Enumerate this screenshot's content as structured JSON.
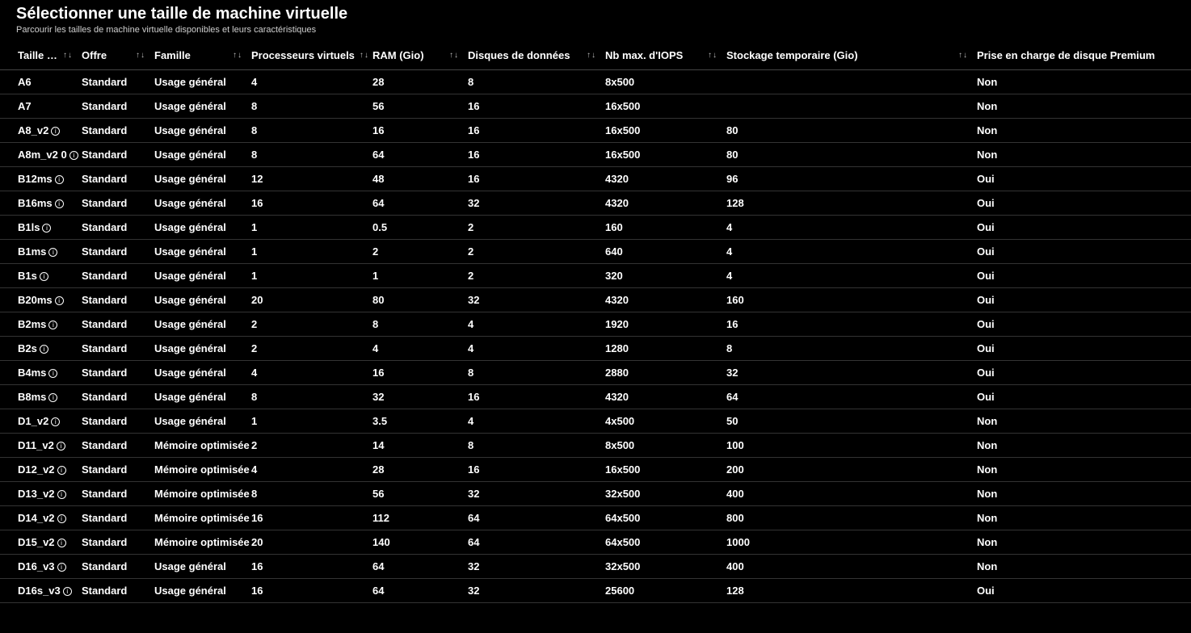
{
  "header": {
    "title": "Sélectionner une taille de machine virtuelle",
    "subtitle": "Parcourir les tailles de machine virtuelle disponibles et leurs caractéristiques"
  },
  "columns": [
    {
      "label": "Taille …",
      "sortable": true
    },
    {
      "label": "Offre",
      "sortable": true
    },
    {
      "label": "Famille",
      "sortable": true
    },
    {
      "label": "Processeurs virtuels",
      "sortable": true
    },
    {
      "label": "RAM (Gio)",
      "sortable": true
    },
    {
      "label": "Disques de données",
      "sortable": true
    },
    {
      "label": "Nb max. d'IOPS",
      "sortable": true
    },
    {
      "label": "Stockage temporaire (Gio)",
      "sortable": true
    },
    {
      "label": "Prise en charge de disque Premium",
      "sortable": false
    }
  ],
  "rows": [
    {
      "size": "A6",
      "info": false,
      "note": "",
      "offer": "Standard",
      "family": "Usage général",
      "vcpu": "4",
      "ram": "28",
      "disks": "8",
      "iops": "8x500",
      "temp": "",
      "premium": "Non"
    },
    {
      "size": "A7",
      "info": false,
      "note": "",
      "offer": "Standard",
      "family": "Usage général",
      "vcpu": "8",
      "ram": "56",
      "disks": "16",
      "iops": "16x500",
      "temp": "",
      "premium": "Non"
    },
    {
      "size": "A8_v2",
      "info": true,
      "note": "",
      "offer": "Standard",
      "family": "Usage général",
      "vcpu": "8",
      "ram": "16",
      "disks": "16",
      "iops": "16x500",
      "temp": "80",
      "premium": "Non"
    },
    {
      "size": "A8m_v2",
      "info": true,
      "note": "0",
      "offer": "Standard",
      "family": "Usage général",
      "vcpu": "8",
      "ram": "64",
      "disks": "16",
      "iops": "16x500",
      "temp": "80",
      "premium": "Non"
    },
    {
      "size": "B12ms",
      "info": true,
      "note": "",
      "offer": "Standard",
      "family": "Usage général",
      "vcpu": "12",
      "ram": "48",
      "disks": "16",
      "iops": "4320",
      "temp": "96",
      "premium": "Oui"
    },
    {
      "size": "B16ms",
      "info": true,
      "note": "",
      "offer": "Standard",
      "family": "Usage général",
      "vcpu": "16",
      "ram": "64",
      "disks": "32",
      "iops": "4320",
      "temp": "128",
      "premium": "Oui"
    },
    {
      "size": "B1ls",
      "info": true,
      "note": "",
      "offer": "Standard",
      "family": "Usage général",
      "vcpu": "1",
      "ram": "0.5",
      "disks": "2",
      "iops": "160",
      "temp": "4",
      "premium": "Oui"
    },
    {
      "size": "B1ms",
      "info": true,
      "note": "",
      "offer": "Standard",
      "family": "Usage général",
      "vcpu": "1",
      "ram": "2",
      "disks": "2",
      "iops": "640",
      "temp": "4",
      "premium": "Oui"
    },
    {
      "size": "B1s",
      "info": true,
      "note": "",
      "offer": "Standard",
      "family": "Usage général",
      "vcpu": "1",
      "ram": "1",
      "disks": "2",
      "iops": "320",
      "temp": "4",
      "premium": "Oui"
    },
    {
      "size": "B20ms",
      "info": true,
      "note": "",
      "offer": "Standard",
      "family": "Usage général",
      "vcpu": "20",
      "ram": "80",
      "disks": "32",
      "iops": "4320",
      "temp": "160",
      "premium": "Oui"
    },
    {
      "size": "B2ms",
      "info": true,
      "note": "",
      "offer": "Standard",
      "family": "Usage général",
      "vcpu": "2",
      "ram": "8",
      "disks": "4",
      "iops": "1920",
      "temp": "16",
      "premium": "Oui"
    },
    {
      "size": "B2s",
      "info": true,
      "note": "",
      "offer": "Standard",
      "family": "Usage général",
      "vcpu": "2",
      "ram": "4",
      "disks": "4",
      "iops": "1280",
      "temp": "8",
      "premium": "Oui"
    },
    {
      "size": "B4ms",
      "info": true,
      "note": "",
      "offer": "Standard",
      "family": "Usage général",
      "vcpu": "4",
      "ram": "16",
      "disks": "8",
      "iops": "2880",
      "temp": "32",
      "premium": "Oui"
    },
    {
      "size": "B8ms",
      "info": true,
      "note": "",
      "offer": "Standard",
      "family": "Usage général",
      "vcpu": "8",
      "ram": "32",
      "disks": "16",
      "iops": "4320",
      "temp": "64",
      "premium": "Oui"
    },
    {
      "size": "D1_v2",
      "info": true,
      "note": "",
      "offer": "Standard",
      "family": "Usage général",
      "vcpu": "1",
      "ram": "3.5",
      "disks": "4",
      "iops": "4x500",
      "temp": "50",
      "premium": "Non"
    },
    {
      "size": "D11_v2",
      "info": true,
      "note": "",
      "offer": "Standard",
      "family": "Mémoire optimisée",
      "vcpu": "2",
      "ram": "14",
      "disks": "8",
      "iops": "8x500",
      "temp": "100",
      "premium": "Non"
    },
    {
      "size": "D12_v2",
      "info": true,
      "note": "",
      "offer": "Standard",
      "family": "Mémoire optimisée",
      "vcpu": "4",
      "ram": "28",
      "disks": "16",
      "iops": "16x500",
      "temp": "200",
      "premium": "Non"
    },
    {
      "size": "D13_v2",
      "info": true,
      "note": "",
      "offer": "Standard",
      "family": "Mémoire optimisée",
      "vcpu": "8",
      "ram": "56",
      "disks": "32",
      "iops": "32x500",
      "temp": "400",
      "premium": "Non"
    },
    {
      "size": "D14_v2",
      "info": true,
      "note": "",
      "offer": "Standard",
      "family": "Mémoire optimisée",
      "vcpu": "16",
      "ram": "112",
      "disks": "64",
      "iops": "64x500",
      "temp": "800",
      "premium": "Non"
    },
    {
      "size": "D15_v2",
      "info": true,
      "note": "",
      "offer": "Standard",
      "family": "Mémoire optimisée",
      "vcpu": "20",
      "ram": "140",
      "disks": "64",
      "iops": "64x500",
      "temp": "1000",
      "premium": "Non"
    },
    {
      "size": "D16_v3",
      "info": true,
      "note": "",
      "offer": "Standard",
      "family": "Usage général",
      "vcpu": "16",
      "ram": "64",
      "disks": "32",
      "iops": "32x500",
      "temp": "400",
      "premium": "Non"
    },
    {
      "size": "D16s_v3",
      "info": true,
      "note": "",
      "offer": "Standard",
      "family": "Usage général",
      "vcpu": "16",
      "ram": "64",
      "disks": "32",
      "iops": "25600",
      "temp": "128",
      "premium": "Oui"
    }
  ]
}
